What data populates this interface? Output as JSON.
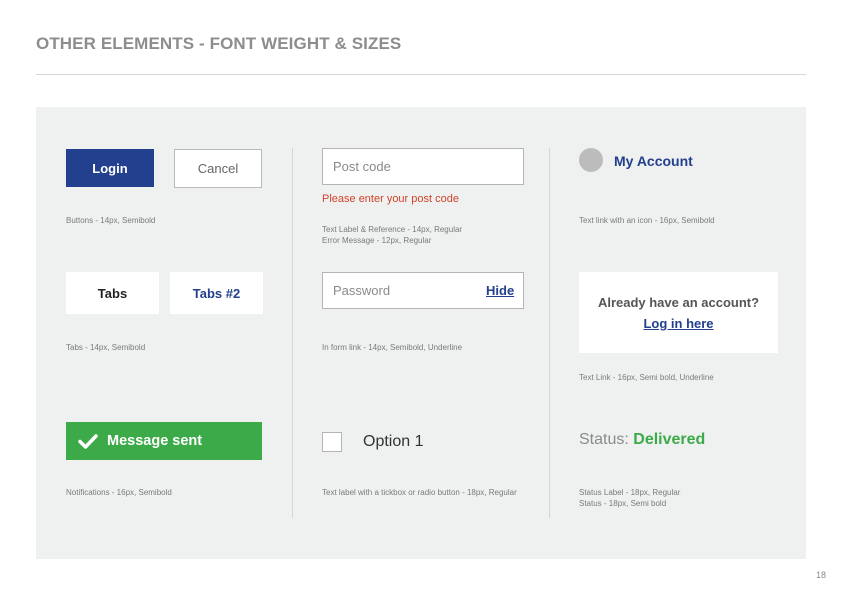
{
  "page": {
    "title": "OTHER ELEMENTS - FONT WEIGHT & SIZES",
    "page_number": "18"
  },
  "column1": {
    "buttons": {
      "login_label": "Login",
      "cancel_label": "Cancel",
      "caption": "Buttons - 14px, Semibold"
    },
    "tabs": {
      "tab1_label": "Tabs",
      "tab2_label": "Tabs #2",
      "caption": "Tabs - 14px, Semibold"
    },
    "notification": {
      "text": "Message sent",
      "icon": "checkmark-icon",
      "caption": "Notifications - 16px, Semibold"
    }
  },
  "column2": {
    "postcode": {
      "placeholder": "Post code",
      "error": "Please enter your post code",
      "caption_line1": "Text Label & Reference - 14px, Regular",
      "caption_line2": "Error Message - 12px, Regular"
    },
    "password": {
      "placeholder": "Password",
      "link": "Hide",
      "caption": "In form link - 14px, Semibold, Underline"
    },
    "checkbox": {
      "label": "Option 1",
      "checked": false,
      "caption": "Text label with a tickbox or radio button - 18px, Regular"
    }
  },
  "column3": {
    "account": {
      "label": "My Account",
      "caption": "Text link with an icon - 16px, Semibold"
    },
    "card": {
      "text": "Already have an account?",
      "link": "Log in here",
      "caption": "Text Link - 16px, Semi bold, Underline"
    },
    "status": {
      "label": "Status:",
      "value": "Delivered",
      "caption_line1": "Status Label - 18px, Regular",
      "caption_line2": "Status - 18px, Semi bold"
    }
  },
  "colors": {
    "primary": "#23408e",
    "success": "#3daa4a",
    "error": "#d0432b",
    "panel": "#eff1f0"
  }
}
